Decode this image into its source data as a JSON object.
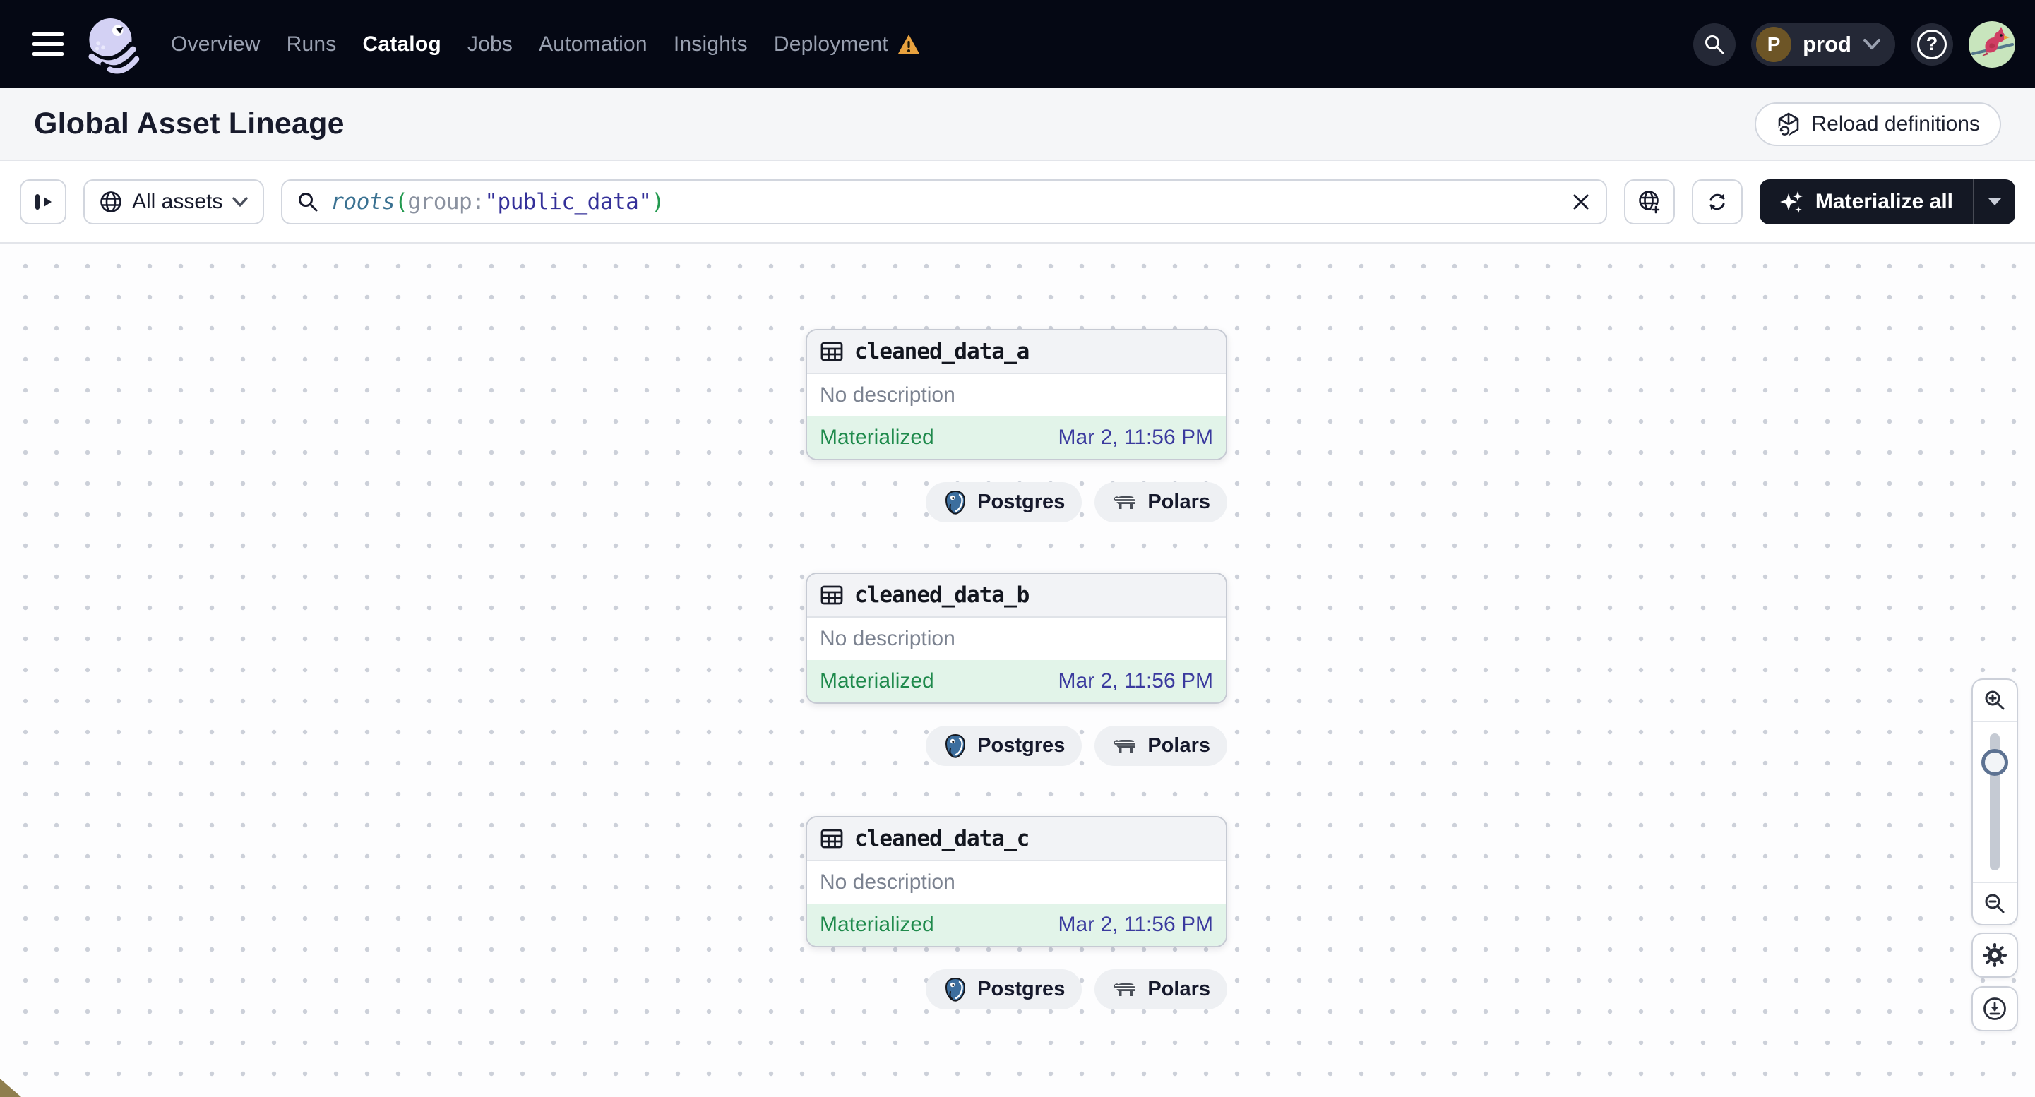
{
  "navbar": {
    "items": [
      {
        "label": "Overview",
        "active": false,
        "warning": false
      },
      {
        "label": "Runs",
        "active": false,
        "warning": false
      },
      {
        "label": "Catalog",
        "active": true,
        "warning": false
      },
      {
        "label": "Jobs",
        "active": false,
        "warning": false
      },
      {
        "label": "Automation",
        "active": false,
        "warning": false
      },
      {
        "label": "Insights",
        "active": false,
        "warning": false
      },
      {
        "label": "Deployment",
        "active": false,
        "warning": true
      }
    ],
    "environment": {
      "initial": "P",
      "label": "prod"
    },
    "help_label": "?"
  },
  "header": {
    "title": "Global Asset Lineage",
    "reload_button": "Reload definitions"
  },
  "toolbar": {
    "filter_button": "All assets",
    "search": {
      "tokens": [
        {
          "text": "roots"
        },
        {
          "text": "("
        },
        {
          "text": "group:"
        },
        {
          "text": "\"public_data\""
        },
        {
          "text": ")"
        }
      ]
    },
    "materialize_button": "Materialize all"
  },
  "nodes": [
    {
      "name": "cleaned_data_a",
      "description": "No description",
      "status": "Materialized",
      "timestamp": "Mar 2, 11:56 PM",
      "tags": [
        {
          "label": "Postgres"
        },
        {
          "label": "Polars"
        }
      ]
    },
    {
      "name": "cleaned_data_b",
      "description": "No description",
      "status": "Materialized",
      "timestamp": "Mar 2, 11:56 PM",
      "tags": [
        {
          "label": "Postgres"
        },
        {
          "label": "Polars"
        }
      ]
    },
    {
      "name": "cleaned_data_c",
      "description": "No description",
      "status": "Materialized",
      "timestamp": "Mar 2, 11:56 PM",
      "tags": [
        {
          "label": "Postgres"
        },
        {
          "label": "Polars"
        }
      ]
    }
  ],
  "colors": {
    "navbar_bg": "#050814",
    "accent_dark": "#141824",
    "status_green": "#1f8a4c",
    "status_green_bg": "#e2f4e9",
    "timestamp_blue": "#3a3a9e",
    "warning_orange": "#e9a23f",
    "logo_lavender": "#d3d1f4",
    "postgres_blue": "#3c6e9e"
  }
}
